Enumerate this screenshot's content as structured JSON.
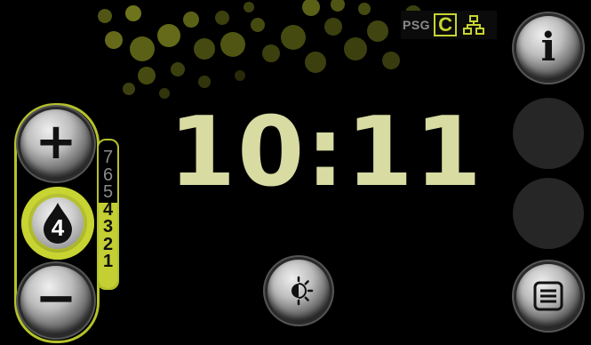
{
  "status": {
    "psg_label": "PSG",
    "unit_label": "C",
    "network_icon": "network-icon"
  },
  "clock": {
    "time": "10:11"
  },
  "buttons": {
    "info_icon": "i",
    "plus_icon": "+",
    "minus_icon": "−",
    "menu_icon": "list-icon",
    "brightness_icon": "brightness-icon"
  },
  "level": {
    "current": "4"
  },
  "scale": {
    "levels": [
      "7",
      "6",
      "5",
      "4",
      "3",
      "2",
      "1"
    ],
    "active_from": 4
  },
  "colors": {
    "accent": "#c7d431",
    "clock": "#d8dba2",
    "background": "#000000"
  }
}
